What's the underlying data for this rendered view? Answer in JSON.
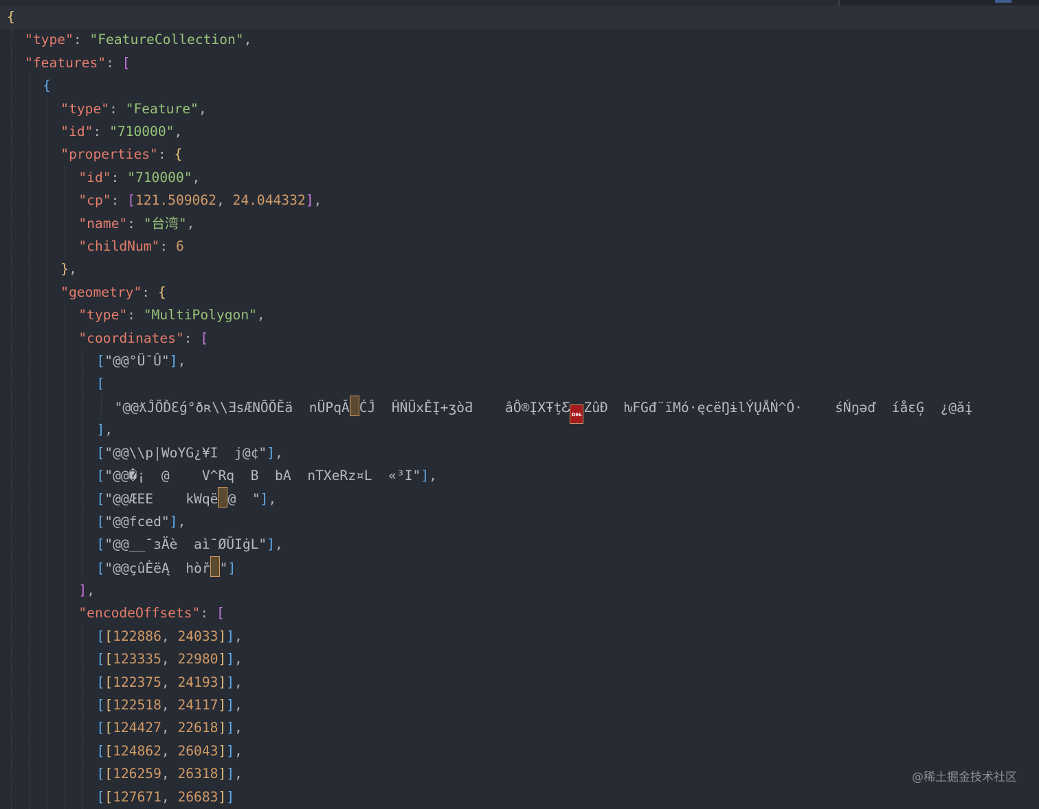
{
  "editor": {
    "language": "json",
    "lines": [
      "{",
      "  \"type\": \"FeatureCollection\",",
      "  \"features\": [",
      "    {",
      "      \"type\": \"Feature\",",
      "      \"id\": \"710000\",",
      "      \"properties\": {",
      "        \"id\": \"710000\",",
      "        \"cp\": [121.509062, 24.044332],",
      "        \"name\": \"台湾\",",
      "        \"childNum\": 6",
      "      },",
      "      \"geometry\": {",
      "        \"type\": \"MultiPolygon\",",
      "        \"coordinates\": [",
      "          [\"@@°Ü¯Û\"],",
      "          [",
      "            \"@@ƛĴÕĎƐǵ°ðʀ\\\\ƎsÆNŌÕĔä  nÜPqĂ|ĆĴ  ĤŃŨxĚĮ+ʒòƋ    âÔ®ĮXŦţƸ ZûĐ  ƕFGđ¨ïMó·ęcëŊɨlÝŲÅŃ^Ó·    śŃŋəď  íåɛĢ  ¿@ăį",
      "          ],",
      "          [\"@@\\\\p|WoYG¿¥I  j@¢\"],",
      "          [\"@@�¡  @    V^Rq  B  bA  nTXeRz¤L  «³I\"],",
      "          [\"@@ÆEE    kWqë @  \"],",
      "          [\"@@fced\"],",
      "          [\"@@__¯ɜÄè  aì¯ØŬIġL\"],",
      "          [\"@@çûĖëĄ  hòř \"]",
      "        ],",
      "        \"encodeOffsets\": [",
      "          [[122886, 24033]],",
      "          [[123335, 22980]],",
      "          [[122375, 24193]],",
      "          [[122518, 24117]],",
      "          [[124427, 22618]],",
      "          [[124862, 26043]],",
      "          [[126259, 26318]],",
      "          [[127671, 26683]]"
    ],
    "json_keys": {
      "type_value": "FeatureCollection",
      "feature_type": "Feature",
      "feature_id": "710000",
      "prop_id": "710000",
      "cp": [
        121.509062,
        24.044332
      ],
      "name": "台湾",
      "childNum": 6,
      "geometry_type": "MultiPolygon",
      "encodeOffsets": [
        [
          122886,
          24033
        ],
        [
          123335,
          22980
        ],
        [
          122375,
          24193
        ],
        [
          122518,
          24117
        ],
        [
          124427,
          22618
        ],
        [
          124862,
          26043
        ],
        [
          126259,
          26318
        ],
        [
          127671,
          26683
        ]
      ]
    },
    "del_badge": "DEL",
    "colors": {
      "background": "#272b33",
      "key": "#e37d6c",
      "string": "#98c379",
      "number": "#d19a66",
      "bracket_level1": "#e5c07b",
      "bracket_level2": "#c678dd",
      "bracket_level3": "#61afef"
    }
  },
  "watermark": "@稀土掘金技术社区"
}
